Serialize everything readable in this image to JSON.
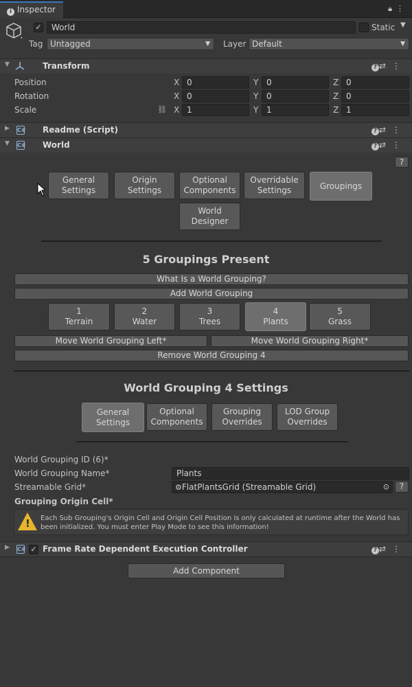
{
  "tab": {
    "label": "Inspector"
  },
  "object": {
    "name": "World",
    "static_label": "Static",
    "tag_label": "Tag",
    "tag_value": "Untagged",
    "layer_label": "Layer",
    "layer_value": "Default"
  },
  "transform": {
    "title": "Transform",
    "rows": [
      {
        "label": "Position",
        "x": "0",
        "y": "0",
        "z": "0"
      },
      {
        "label": "Rotation",
        "x": "0",
        "y": "0",
        "z": "0"
      },
      {
        "label": "Scale",
        "x": "1",
        "y": "1",
        "z": "1"
      }
    ],
    "axis": {
      "x": "X",
      "y": "Y",
      "z": "Z"
    }
  },
  "readme": {
    "title": "Readme (Script)"
  },
  "world": {
    "title": "World",
    "help_button": "?",
    "tabs": [
      "General\nSettings",
      "Origin\nSettings",
      "Optional\nComponents",
      "Overridable\nSettings",
      "Groupings",
      "World\nDesigner"
    ],
    "groupings_heading": "5 Groupings Present",
    "what_is_button": "What Is a World Grouping?",
    "add_button": "Add World Grouping",
    "groupings": [
      {
        "num": "1",
        "name": "Terrain"
      },
      {
        "num": "2",
        "name": "Water"
      },
      {
        "num": "3",
        "name": "Trees"
      },
      {
        "num": "4",
        "name": "Plants"
      },
      {
        "num": "5",
        "name": "Grass"
      }
    ],
    "move_left": "Move World Grouping Left*",
    "move_right": "Move World Grouping Right*",
    "remove": "Remove World Grouping 4",
    "settings_heading": "World Grouping 4 Settings",
    "settings_tabs": [
      "General\nSettings",
      "Optional\nComponents",
      "Grouping\nOverrides",
      "LOD Group\nOverrides"
    ],
    "id_label": "World Grouping ID (6)*",
    "name_label": "World Grouping Name*",
    "name_value": "Plants",
    "grid_label": "Streamable Grid*",
    "grid_value": "FlatPlantsGrid (Streamable Grid)",
    "origin_label": "Grouping Origin Cell*",
    "warning": "Each Sub Grouping's Origin Cell and Origin Cell Position is only calculated at runtime after the World has been initialized. You must enter Play Mode to see this information!"
  },
  "frame_rate": {
    "title": "Frame Rate Dependent Execution Controller"
  },
  "add_component": "Add Component",
  "colors": {
    "accent": "#3a79bb",
    "warning": "#e8b42e",
    "background": "#383838"
  }
}
